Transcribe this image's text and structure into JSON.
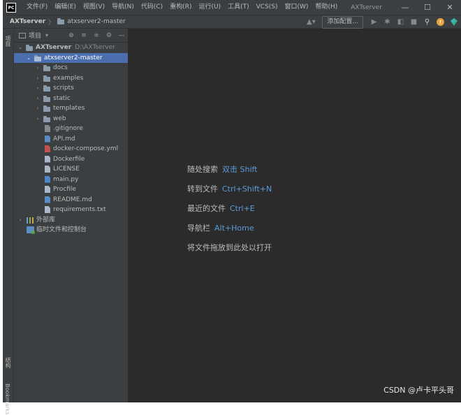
{
  "titlebar": {
    "logo": "PC",
    "menu": [
      "文件(F)",
      "编辑(E)",
      "视图(V)",
      "导航(N)",
      "代码(C)",
      "重构(R)",
      "运行(U)",
      "工具(T)",
      "VCS(S)",
      "窗口(W)",
      "帮助(H)"
    ],
    "window_title": "AXTserver",
    "minimize": "—",
    "maximize": "☐",
    "close": "✕"
  },
  "navbar": {
    "root": "AXTserver",
    "separator": "〉",
    "child": "atxserver2-master",
    "user_icon": "▲▾",
    "add_config": "添加配置...",
    "run_icon": "▶",
    "debug_icon": "✱",
    "coverage_icon": "◧",
    "stop_icon": "■",
    "search_icon": "⚲",
    "update_icon": "↑"
  },
  "stripe": {
    "project_tab": "项目",
    "structure_tab": "结构",
    "bookmarks_tab": "Bookmarks"
  },
  "panel": {
    "title": "项目",
    "caret": "▾",
    "tools": [
      "⊕",
      "≡",
      "≑",
      "⚙",
      "—"
    ]
  },
  "tree": {
    "root_label": "AXTserver",
    "root_path": "D:\\AXTserver",
    "selected_label": "atxserver2-master",
    "folders": [
      "docs",
      "examples",
      "scripts",
      "static",
      "templates",
      "web"
    ],
    "files": [
      ".gitignore",
      "API.md",
      "docker-compose.yml",
      "Dockerfile",
      "LICENSE",
      "main.py",
      "Procfile",
      "README.md",
      "requirements.txt"
    ],
    "external_libs": "外部库",
    "scratches": "临时文件和控制台",
    "collapsed_arrow": "›",
    "expanded_arrow": "⌄"
  },
  "editor": {
    "hints": [
      {
        "label": "随处搜索",
        "key": "双击 Shift"
      },
      {
        "label": "转到文件",
        "key": "Ctrl+Shift+N"
      },
      {
        "label": "最近的文件",
        "key": "Ctrl+E"
      },
      {
        "label": "导航栏",
        "key": "Alt+Home"
      },
      {
        "label": "将文件拖放到此处以打开",
        "key": ""
      }
    ]
  },
  "watermark": "CSDN @卢卡平头哥",
  "colors": {
    "background": "#2b2b2b",
    "chrome": "#3c3f41",
    "selection": "#4b6eaf",
    "shortcut": "#5c9bd8"
  }
}
